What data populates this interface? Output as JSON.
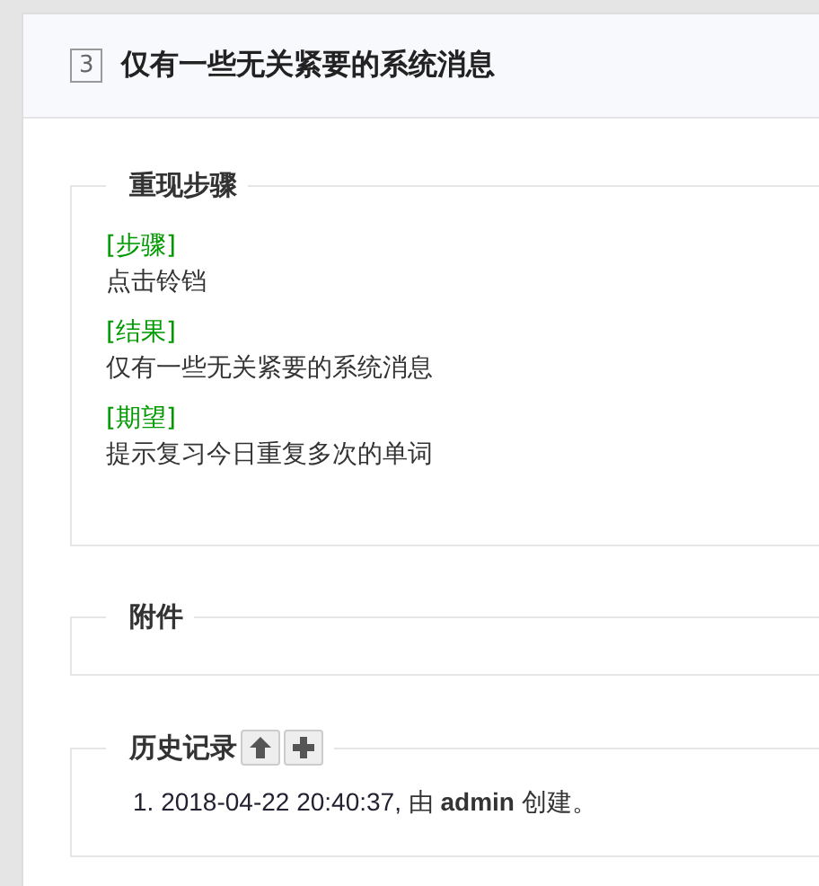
{
  "header": {
    "id": "3",
    "title": "仅有一些无关紧要的系统消息"
  },
  "steps_section": {
    "legend": "重现步骤",
    "blocks": [
      {
        "label": "[步骤]",
        "text": "点击铃铛"
      },
      {
        "label": "[结果]",
        "text": "仅有一些无关紧要的系统消息"
      },
      {
        "label": "[期望]",
        "text": "提示复习今日重复多次的单词"
      }
    ]
  },
  "files_section": {
    "legend": "附件"
  },
  "history_section": {
    "legend": "历史记录",
    "buttons": [
      {
        "kind": "up"
      },
      {
        "kind": "add"
      }
    ],
    "entries": [
      {
        "number": "1.",
        "date": "2018-04-22 20:40:37,",
        "text": "由 **admin** 创建。"
      }
    ]
  }
}
